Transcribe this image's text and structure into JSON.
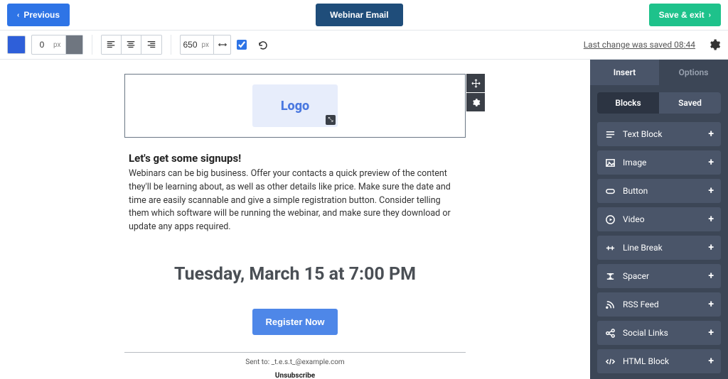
{
  "topbar": {
    "previous_label": "Previous",
    "title": "Webinar Email",
    "save_exit_label": "Save & exit"
  },
  "toolbar": {
    "border_width_value": "0",
    "border_width_unit": "px",
    "canvas_width_value": "650",
    "canvas_width_unit": "px",
    "checkbox_checked": true,
    "save_status": "Last change was saved 08:44"
  },
  "email": {
    "logo_text": "Logo",
    "headline": "Let's get some signups!",
    "body": "Webinars can be big business. Offer your contacts a quick preview of the content they'll be learning about, as well as other details like price. Make sure the date and time are easily scannable and give a simple registration button. Consider telling them which software will be running the webinar, and make sure they download or update any apps required.",
    "event_time": "Tuesday, March 15 at 7:00 PM",
    "register_label": "Register Now",
    "sent_to": "Sent to: _t.e.s.t_@example.com",
    "unsubscribe_label": "Unsubscribe"
  },
  "panel": {
    "tab_insert": "Insert",
    "tab_options": "Options",
    "seg_blocks": "Blocks",
    "seg_saved": "Saved",
    "blocks": [
      {
        "label": "Text Block"
      },
      {
        "label": "Image"
      },
      {
        "label": "Button"
      },
      {
        "label": "Video"
      },
      {
        "label": "Line Break"
      },
      {
        "label": "Spacer"
      },
      {
        "label": "RSS Feed"
      },
      {
        "label": "Social Links"
      },
      {
        "label": "HTML Block"
      }
    ]
  }
}
